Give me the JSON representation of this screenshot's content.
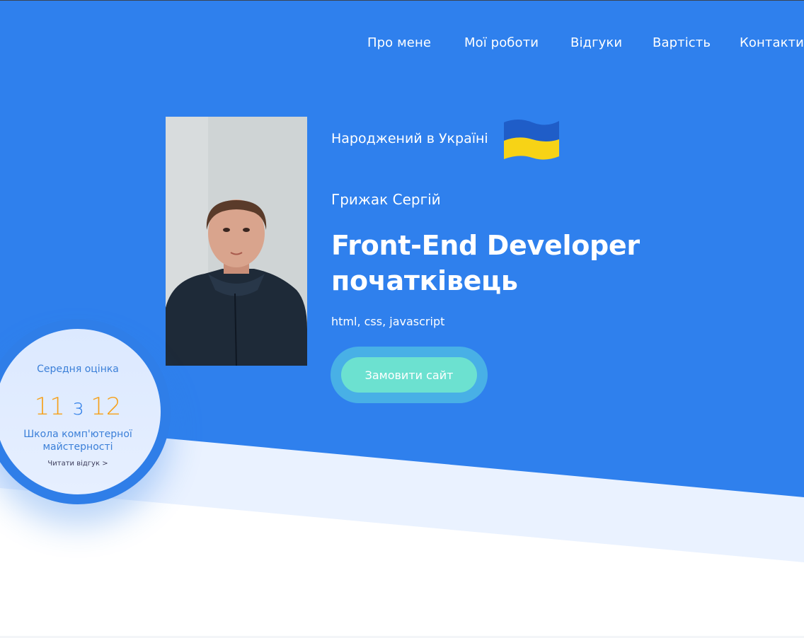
{
  "nav": {
    "items": [
      {
        "label": "Про мене"
      },
      {
        "label": "Мої роботи"
      },
      {
        "label": "Відгуки"
      },
      {
        "label": "Вартість"
      },
      {
        "label": "Контакти"
      }
    ]
  },
  "hero": {
    "born": "Народжений в Україні",
    "name": "Грижак Сергій",
    "headline_line1": "Front-End Developer",
    "headline_line2": "початківець",
    "skills": "html, css, javascript",
    "cta_label": "Замовити сайт"
  },
  "rating": {
    "title": "Середня оцінка",
    "score": "11",
    "separator": "з",
    "max": "12",
    "school": "Школа комп'ютерної майстерності",
    "link_label": "Читати відгук >"
  },
  "colors": {
    "primary_blue": "#2f80ed",
    "accent_orange": "#f6a01a",
    "cta_mint": "#6ce1d0",
    "cta_ring": "#48b0e6",
    "light_band": "#eaf2ff"
  },
  "icons": {
    "flag": "ukraine-flag-icon"
  }
}
